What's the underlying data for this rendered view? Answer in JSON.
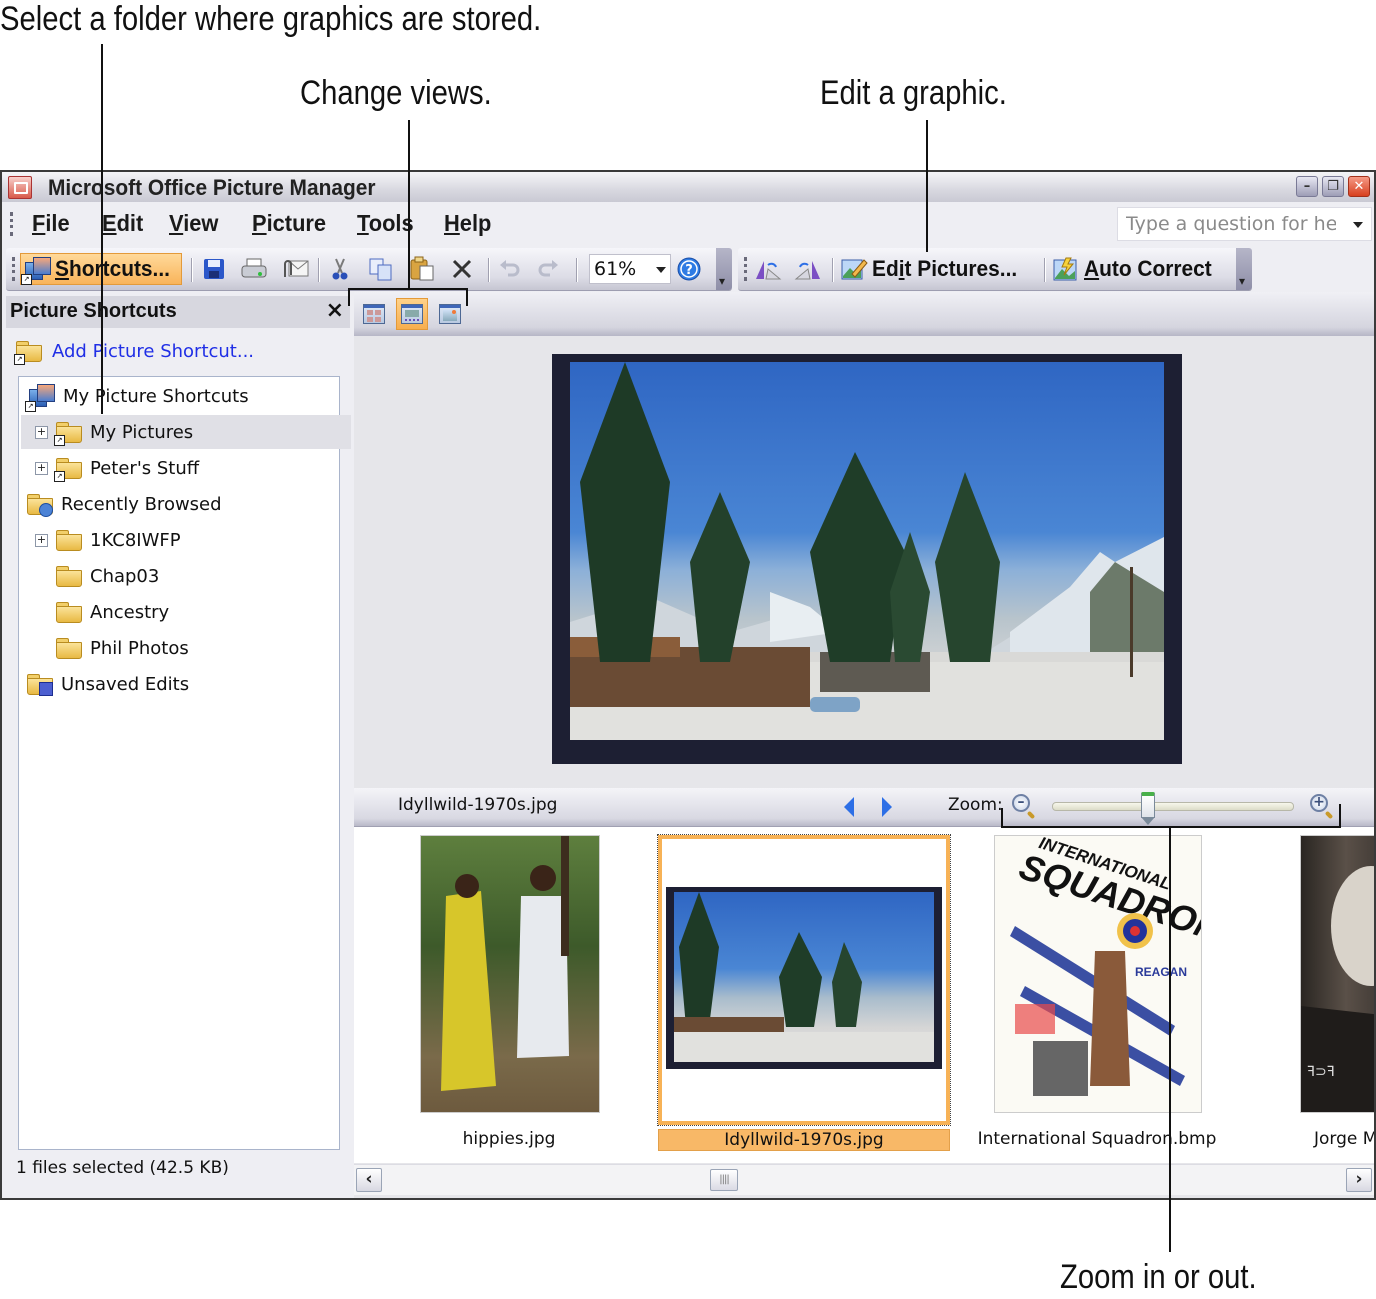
{
  "callouts": {
    "select_folder": "Select a folder where graphics are stored.",
    "change_views": "Change views.",
    "edit_graphic": "Edit a graphic.",
    "zoom": "Zoom in or out."
  },
  "window": {
    "title": "Microsoft Office Picture Manager",
    "buttons": {
      "minimize": "–",
      "restore": "❐",
      "close": "✕"
    }
  },
  "menu": {
    "items": [
      {
        "u": "F",
        "rest": "ile"
      },
      {
        "u": "E",
        "rest": "dit"
      },
      {
        "u": "V",
        "rest": "iew"
      },
      {
        "u": "P",
        "rest": "icture"
      },
      {
        "u": "T",
        "rest": "ools"
      },
      {
        "u": "H",
        "rest": "elp"
      }
    ],
    "help_placeholder": "Type a question for help"
  },
  "toolbar": {
    "shortcuts": {
      "u": "S",
      "rest": "hortcuts..."
    },
    "zoom_value": "61%",
    "edit_pictures": {
      "pre": "Ed",
      "u": "i",
      "rest": "t Pictures..."
    },
    "auto_correct": {
      "u": "A",
      "rest": "uto Correct"
    }
  },
  "left_pane": {
    "title": "Picture Shortcuts",
    "close": "×",
    "add_link": "Add Picture Shortcut...",
    "tree": [
      {
        "label": "My Picture Shortcuts",
        "level": 0,
        "icon": "pictures-shortcut-icon"
      },
      {
        "label": "My Pictures",
        "level": 1,
        "icon": "pictures-folder-icon",
        "expander": "+",
        "selected": true
      },
      {
        "label": "Peter's Stuff",
        "level": 1,
        "icon": "folder-shortcut-icon",
        "expander": "+"
      },
      {
        "label": "Recently Browsed",
        "level": 0,
        "icon": "recent-folder-icon"
      },
      {
        "label": "1KC8IWFP",
        "level": 1,
        "icon": "folder-icon",
        "expander": "+"
      },
      {
        "label": "Chap03",
        "level": 1,
        "icon": "folder-icon"
      },
      {
        "label": "Ancestry",
        "level": 1,
        "icon": "folder-icon"
      },
      {
        "label": "Phil Photos",
        "level": 1,
        "icon": "folder-icon"
      },
      {
        "label": "Unsaved Edits",
        "level": 0,
        "icon": "unsaved-edits-icon"
      }
    ],
    "status": "1 files selected (42.5 KB)"
  },
  "viewer": {
    "view_modes": [
      "thumbnail-view",
      "filmstrip-view",
      "single-picture-view"
    ],
    "active_view": "filmstrip-view",
    "current_file": "Idyllwild-1970s.jpg",
    "zoom_label": "Zoom:",
    "zoom_slider_fraction": 0.4,
    "thumbnails": [
      {
        "name": "hippies.jpg",
        "selected": false
      },
      {
        "name": "Idyllwild-1970s.jpg",
        "selected": true
      },
      {
        "name": "International Squadron.bmp",
        "selected": false
      },
      {
        "name": "Jorge M",
        "selected": false
      }
    ],
    "poster_text": {
      "line1": "INTERNATIONAL",
      "line2": "SQUADRON",
      "actor": "REAGAN"
    }
  },
  "scrollbar": {
    "left": "‹",
    "right": "›",
    "grip": "||||"
  }
}
